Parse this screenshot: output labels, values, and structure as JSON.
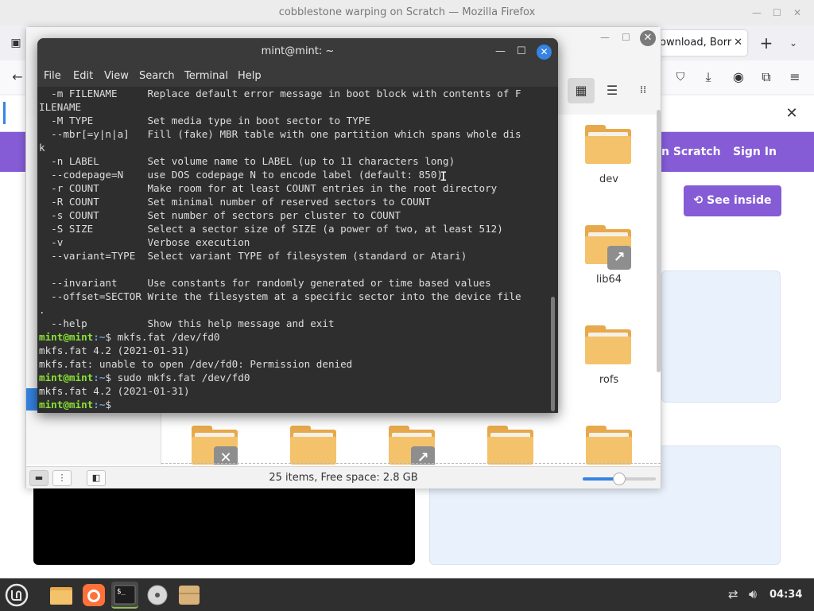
{
  "firefox": {
    "window_title": "cobblestone warping on Scratch — Mozilla Firefox",
    "tab_right_title": "ownload, Borr",
    "scratch_nav": {
      "link1": "n Scratch",
      "sign_in": "Sign In"
    },
    "see_inside": "See inside"
  },
  "file_manager": {
    "items": [
      {
        "name": "dev"
      },
      {
        "name": "lib64"
      },
      {
        "name": "rofs"
      }
    ],
    "status": "25 items, Free space: 2.8 GB",
    "zoom_level": 0.5
  },
  "terminal": {
    "title": "mint@mint: ~",
    "menu": [
      "File",
      "Edit",
      "View",
      "Search",
      "Terminal",
      "Help"
    ],
    "lines": [
      "  -m FILENAME     Replace default error message in boot block with contents of F",
      "ILENAME",
      "  -M TYPE         Set media type in boot sector to TYPE",
      "  --mbr[=y|n|a]   Fill (fake) MBR table with one partition which spans whole dis",
      "k",
      "  -n LABEL        Set volume name to LABEL (up to 11 characters long)",
      "  --codepage=N    use DOS codepage N to encode label (default: 850)",
      "  -r COUNT        Make room for at least COUNT entries in the root directory",
      "  -R COUNT        Set minimal number of reserved sectors to COUNT",
      "  -s COUNT        Set number of sectors per cluster to COUNT",
      "  -S SIZE         Select a sector size of SIZE (a power of two, at least 512)",
      "  -v              Verbose execution",
      "  --variant=TYPE  Select variant TYPE of filesystem (standard or Atari)",
      "",
      "  --invariant     Use constants for randomly generated or time based values",
      "  --offset=SECTOR Write the filesystem at a specific sector into the device file",
      ".",
      "  --help          Show this help message and exit"
    ],
    "session": [
      {
        "prompt_user": "mint@mint",
        "prompt_path": ":~",
        "prompt_sym": "$ ",
        "cmd": "mkfs.fat /dev/fd0"
      },
      {
        "output": "mkfs.fat 4.2 (2021-01-31)"
      },
      {
        "output": "mkfs.fat: unable to open /dev/fd0: Permission denied"
      },
      {
        "prompt_user": "mint@mint",
        "prompt_path": ":~",
        "prompt_sym": "$ ",
        "cmd": "sudo mkfs.fat /dev/fd0"
      },
      {
        "output": "mkfs.fat 4.2 (2021-01-31)"
      },
      {
        "prompt_user": "mint@mint",
        "prompt_path": ":~",
        "prompt_sym": "$ ",
        "cmd": ""
      }
    ]
  },
  "taskbar": {
    "apps": [
      "menu-icon",
      "files-icon",
      "firefox-icon",
      "terminal-icon",
      "disc-icon",
      "archive-icon"
    ],
    "clock": "04:34"
  }
}
